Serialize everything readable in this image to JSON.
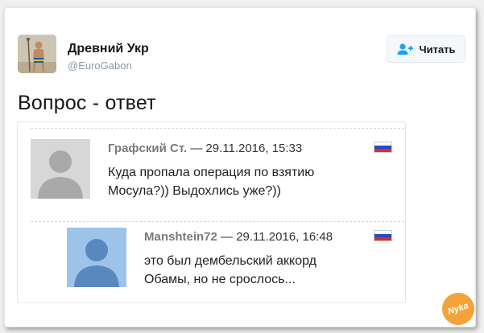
{
  "tweet": {
    "author_name": "Древний Укр",
    "author_handle": "@EuroGabon",
    "follow_label": "Читать",
    "text": "Вопрос - ответ"
  },
  "comments": [
    {
      "name": "Графский Ст.",
      "dash": "—",
      "date": "29.11.2016, 15:33",
      "line1": "Куда пропала операция по взятию",
      "line2": "Мосула?)) Выдохлись уже?))"
    },
    {
      "name": "Manshtein72",
      "dash": "—",
      "date": "29.11.2016, 16:48",
      "line1": "это был дембельский аккорд",
      "line2": "Обамы, но не срослось..."
    }
  ],
  "watermark": "Nyka",
  "colors": {
    "accent": "#1da1f2",
    "handle": "#8899a6",
    "flag_white": "#ffffff",
    "flag_blue": "#2e49c3",
    "flag_red": "#d92c2c"
  },
  "icons": {
    "follow": "add-user-icon",
    "flag": "russia-flag-icon"
  }
}
